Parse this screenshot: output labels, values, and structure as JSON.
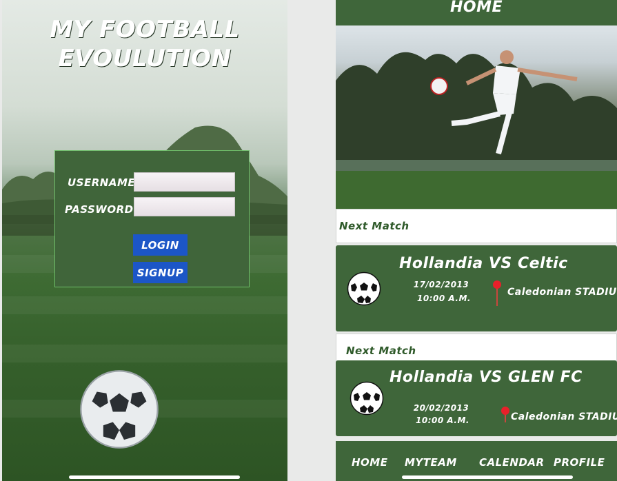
{
  "login": {
    "title_line1": "MY FOOTBALL",
    "title_line2": "EVOULUTION",
    "username_label": "USERNAME",
    "password_label": "PASSWORD",
    "username_value": "",
    "password_value": "",
    "login_button": "LOGIN",
    "signup_button": "SIGNUP"
  },
  "home": {
    "header_title": "HOME",
    "matches": [
      {
        "section_label": "Next Match",
        "title": "Hollandia VS Celtic",
        "date": "17/02/2013",
        "time": "10:00 A.M.",
        "venue": "Caledonian STADIUM"
      },
      {
        "section_label": "Next Match",
        "title": "Hollandia VS GLEN FC",
        "date": "20/02/2013",
        "time": "10:00 A.M.",
        "venue": "Caledonian STADIUM"
      }
    ],
    "tabs": [
      "HOME",
      "MYTEAM",
      "CALENDAR",
      "PROFILE"
    ]
  },
  "colors": {
    "brand_green": "#3f663a",
    "button_blue": "#1c56c7",
    "pin_red": "#e8202a"
  },
  "icons": [
    "soccer-ball-icon",
    "location-pin-icon"
  ]
}
